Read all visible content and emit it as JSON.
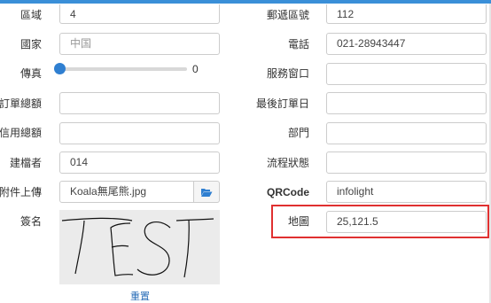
{
  "form": {
    "left": {
      "district": {
        "label": "區域",
        "value": "4"
      },
      "country": {
        "label": "國家",
        "placeholder": "中国"
      },
      "fax": {
        "label": "傳真",
        "slider_value": "0",
        "level": 0
      },
      "order_total": {
        "label": "訂單總額",
        "value": ""
      },
      "credit_total": {
        "label": "信用總額",
        "value": ""
      },
      "creator": {
        "label": "建檔者",
        "value": "014"
      },
      "attachment": {
        "label": "附件上傳",
        "value": "Koala無尾熊.jpg",
        "button_icon": "folder-open-icon"
      },
      "signature": {
        "label": "簽名",
        "content": "TEST",
        "reset_label": "重置"
      }
    },
    "right": {
      "postal_code": {
        "label": "郵遞區號",
        "value": "112"
      },
      "phone": {
        "label": "電話",
        "value": "021-28943447"
      },
      "service_window": {
        "label": "服務窗口",
        "value": ""
      },
      "last_order_date": {
        "label": "最後訂單日",
        "value": ""
      },
      "department": {
        "label": "部門",
        "value": ""
      },
      "process_status": {
        "label": "流程狀態",
        "value": ""
      },
      "qrcode": {
        "label": "QRCode",
        "value": "infolight"
      },
      "map": {
        "label": "地圖",
        "value": "25,121.5",
        "highlighted": true
      }
    }
  },
  "colors": {
    "accent": "#2f7fd1",
    "highlight": "#e03030",
    "link": "#2a6eb8"
  }
}
